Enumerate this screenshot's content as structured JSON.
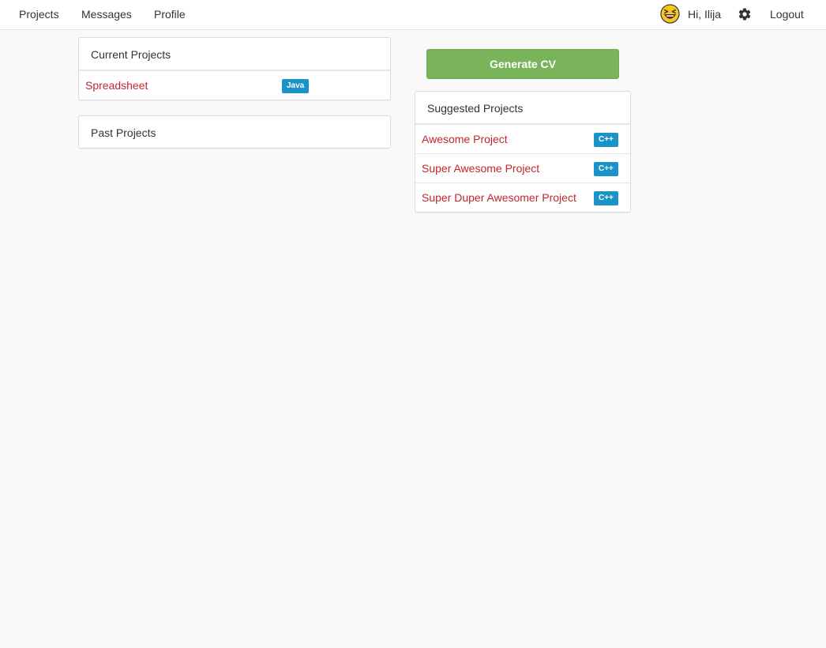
{
  "nav": {
    "projects": "Projects",
    "messages": "Messages",
    "profile": "Profile",
    "greeting": "Hi, Ilija",
    "logout": "Logout",
    "avatar_icon": "laughing-face-icon",
    "settings_icon": "gear-icon"
  },
  "current_projects": {
    "title": "Current Projects",
    "items": [
      {
        "name": "Spreadsheet",
        "tag": "Java"
      }
    ]
  },
  "past_projects": {
    "title": "Past Projects",
    "items": []
  },
  "generate_cv": {
    "label": "Generate CV"
  },
  "suggested_projects": {
    "title": "Suggested Projects",
    "items": [
      {
        "name": "Awesome Project",
        "tag": "C++"
      },
      {
        "name": "Super Awesome Project",
        "tag": "C++"
      },
      {
        "name": "Super Duper Awesomer Project",
        "tag": "C++"
      }
    ]
  },
  "colors": {
    "link": "#c0272d",
    "badge": "#1a94c8",
    "button": "#79b45a",
    "background": "#f9f9f9"
  }
}
